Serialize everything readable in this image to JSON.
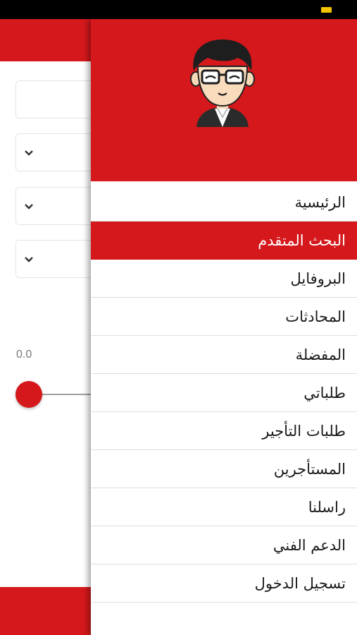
{
  "colors": {
    "primary": "#d5181b",
    "status_bar": "#000000",
    "battery": "#f5c400"
  },
  "status_bar": {
    "battery_icon": "battery-icon"
  },
  "background": {
    "slider_value": "0.0",
    "dropdown_icon": "chevron-down-icon"
  },
  "drawer": {
    "avatar_icon": "cartoon-boy-avatar",
    "menu": [
      {
        "label": "الرئيسية",
        "active": false
      },
      {
        "label": "البحث المتقدم",
        "active": true
      },
      {
        "label": "البروفايل",
        "active": false
      },
      {
        "label": "المحادثات",
        "active": false
      },
      {
        "label": "المفضلة",
        "active": false
      },
      {
        "label": "طلباتي",
        "active": false
      },
      {
        "label": "طلبات التأجير",
        "active": false
      },
      {
        "label": "المستأجرين",
        "active": false
      },
      {
        "label": "راسلنا",
        "active": false
      },
      {
        "label": "الدعم الفني",
        "active": false
      },
      {
        "label": "تسجيل الدخول",
        "active": false
      }
    ]
  }
}
